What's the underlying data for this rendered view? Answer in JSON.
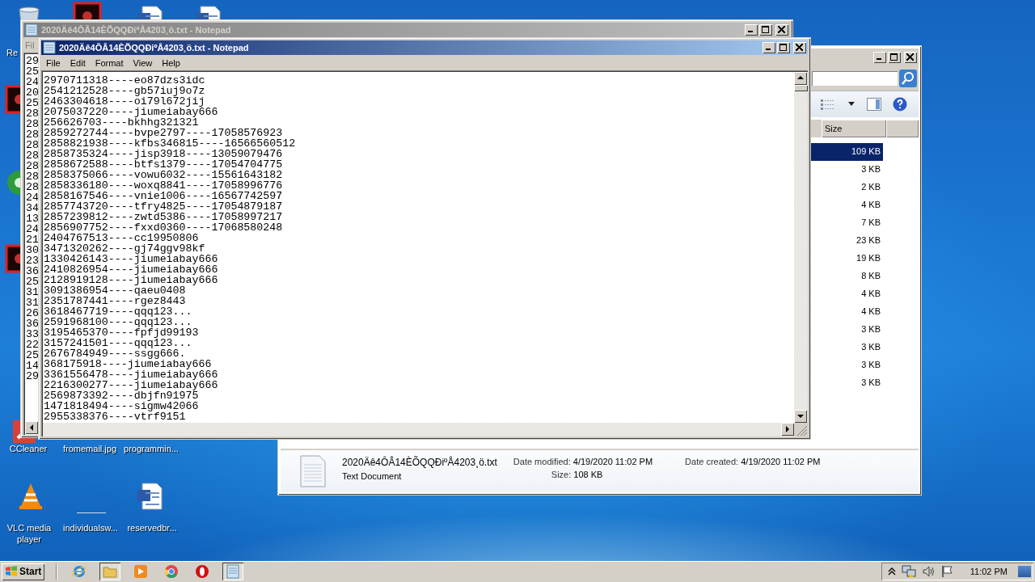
{
  "desktop_icons": [
    {
      "kind": "recycle-bin",
      "label": "Re"
    },
    {
      "kind": "red-app"
    },
    {
      "kind": "word"
    },
    {
      "kind": "word"
    },
    {
      "kind": "red-app"
    },
    {
      "kind": "green-app"
    },
    {
      "kind": "red-app"
    },
    {
      "kind": "cleaner",
      "label": "CCleaner"
    },
    {
      "label": "fromemail.jpg"
    },
    {
      "label": "programmin..."
    },
    {
      "kind": "vlc",
      "label": "VLC media player"
    },
    {
      "kind": "blank",
      "label": "individualsw..."
    },
    {
      "kind": "word",
      "label": "reservedbr..."
    }
  ],
  "explorer": {
    "columns": [
      "Size"
    ],
    "rows": [
      {
        "size": "109 KB",
        "selected": true
      },
      {
        "size": "3 KB",
        "selected": false
      },
      {
        "size": "2 KB",
        "selected": false
      },
      {
        "size": "4 KB",
        "selected": false
      },
      {
        "size": "7 KB",
        "selected": false
      },
      {
        "size": "23 KB",
        "selected": false
      },
      {
        "size": "19 KB",
        "selected": false
      },
      {
        "size": "8 KB",
        "selected": false
      },
      {
        "size": "4 KB",
        "selected": false
      },
      {
        "size": "4 KB",
        "selected": false
      },
      {
        "size": "3 KB",
        "selected": false
      },
      {
        "size": "3 KB",
        "selected": false
      },
      {
        "size": "3 KB",
        "selected": false
      },
      {
        "size": "3 KB",
        "selected": false
      }
    ],
    "details": {
      "name": "2020Äê4ÔÂ14ÈÕQQÐiºÅ4203¸ö.txt",
      "type": "Text Document",
      "modified_label": "Date modified:",
      "modified": "4/19/2020 11:02 PM",
      "size_label": "Size:",
      "size": "108 KB",
      "created_label": "Date created:",
      "created": "4/19/2020 11:02 PM"
    }
  },
  "back_notepad": {
    "title": "2020Äê4ÔÂ14ÈÕQQÐiºÅ4203¸ö.txt - Notepad",
    "menu": [
      "Fil"
    ],
    "lines": [
      "29",
      "25",
      "24",
      "20",
      "25",
      "28",
      "28",
      "28",
      "28",
      "28",
      "28",
      "28",
      "28",
      "24",
      "34",
      "13",
      "24",
      "21",
      "30",
      "23",
      "36",
      "25",
      "31",
      "31",
      "26",
      "36",
      "33",
      "22",
      "25",
      "14",
      "29"
    ]
  },
  "notepad": {
    "title": "2020Äê4ÔÂ14ÈÕQQÐiºÅ4203¸ö.txt - Notepad",
    "menu": [
      "File",
      "Edit",
      "Format",
      "View",
      "Help"
    ],
    "lines": [
      "2970711318----eo87dzs3idc",
      "2541212528----gb57iuj9o7z",
      "2463304618----oi79l672jij",
      "2075037220----jiumeiabay666",
      "256626703----bkhhg321321",
      "2859272744----bvpe2797----17058576923",
      "2858821938----kfbs346815----16566560512",
      "2858735324----jisp3918----13059079476",
      "2858672588----btfs1379----17054704775",
      "2858375066----vowu6032----15561643182",
      "2858336180----woxq8841----17058996776",
      "2858167546----vnie1006----16567742597",
      "2857743720----tfry4825----17054879187",
      "2857239812----zwtd5386----17058997217",
      "2856907752----fxxd0360----17068580248",
      "2404767513----cc19950806",
      "3471320262----gj74ggv98kf",
      "1330426143----jiumeiabay666",
      "2410826954----jiumeiabay666",
      "2128919128----jiumeiabay666",
      "3091386954----qaeu0408",
      "2351787441----rgez8443",
      "3618467719----qqq123...",
      "2591968100----qqq123...",
      "3195465370----fpfjd99193",
      "3157241501----qqq123...",
      "2676784949----ssgg666.",
      "368175918----jiumeiabay666",
      "3361556478----jiumeiabay666",
      "2216300277----jiumeiabay666",
      "2569873392----dbjfn91975",
      "1471818494----sigmw42066",
      "2955338376----vtrf9151"
    ]
  },
  "taskbar": {
    "start": "Start",
    "apps": [
      {
        "kind": "ie",
        "open": false
      },
      {
        "kind": "folder",
        "open": true
      },
      {
        "kind": "media",
        "open": false
      },
      {
        "kind": "chrome",
        "open": false
      },
      {
        "kind": "opera",
        "open": false
      },
      {
        "kind": "notepad",
        "open": true
      }
    ],
    "clock": "11:02 PM"
  }
}
